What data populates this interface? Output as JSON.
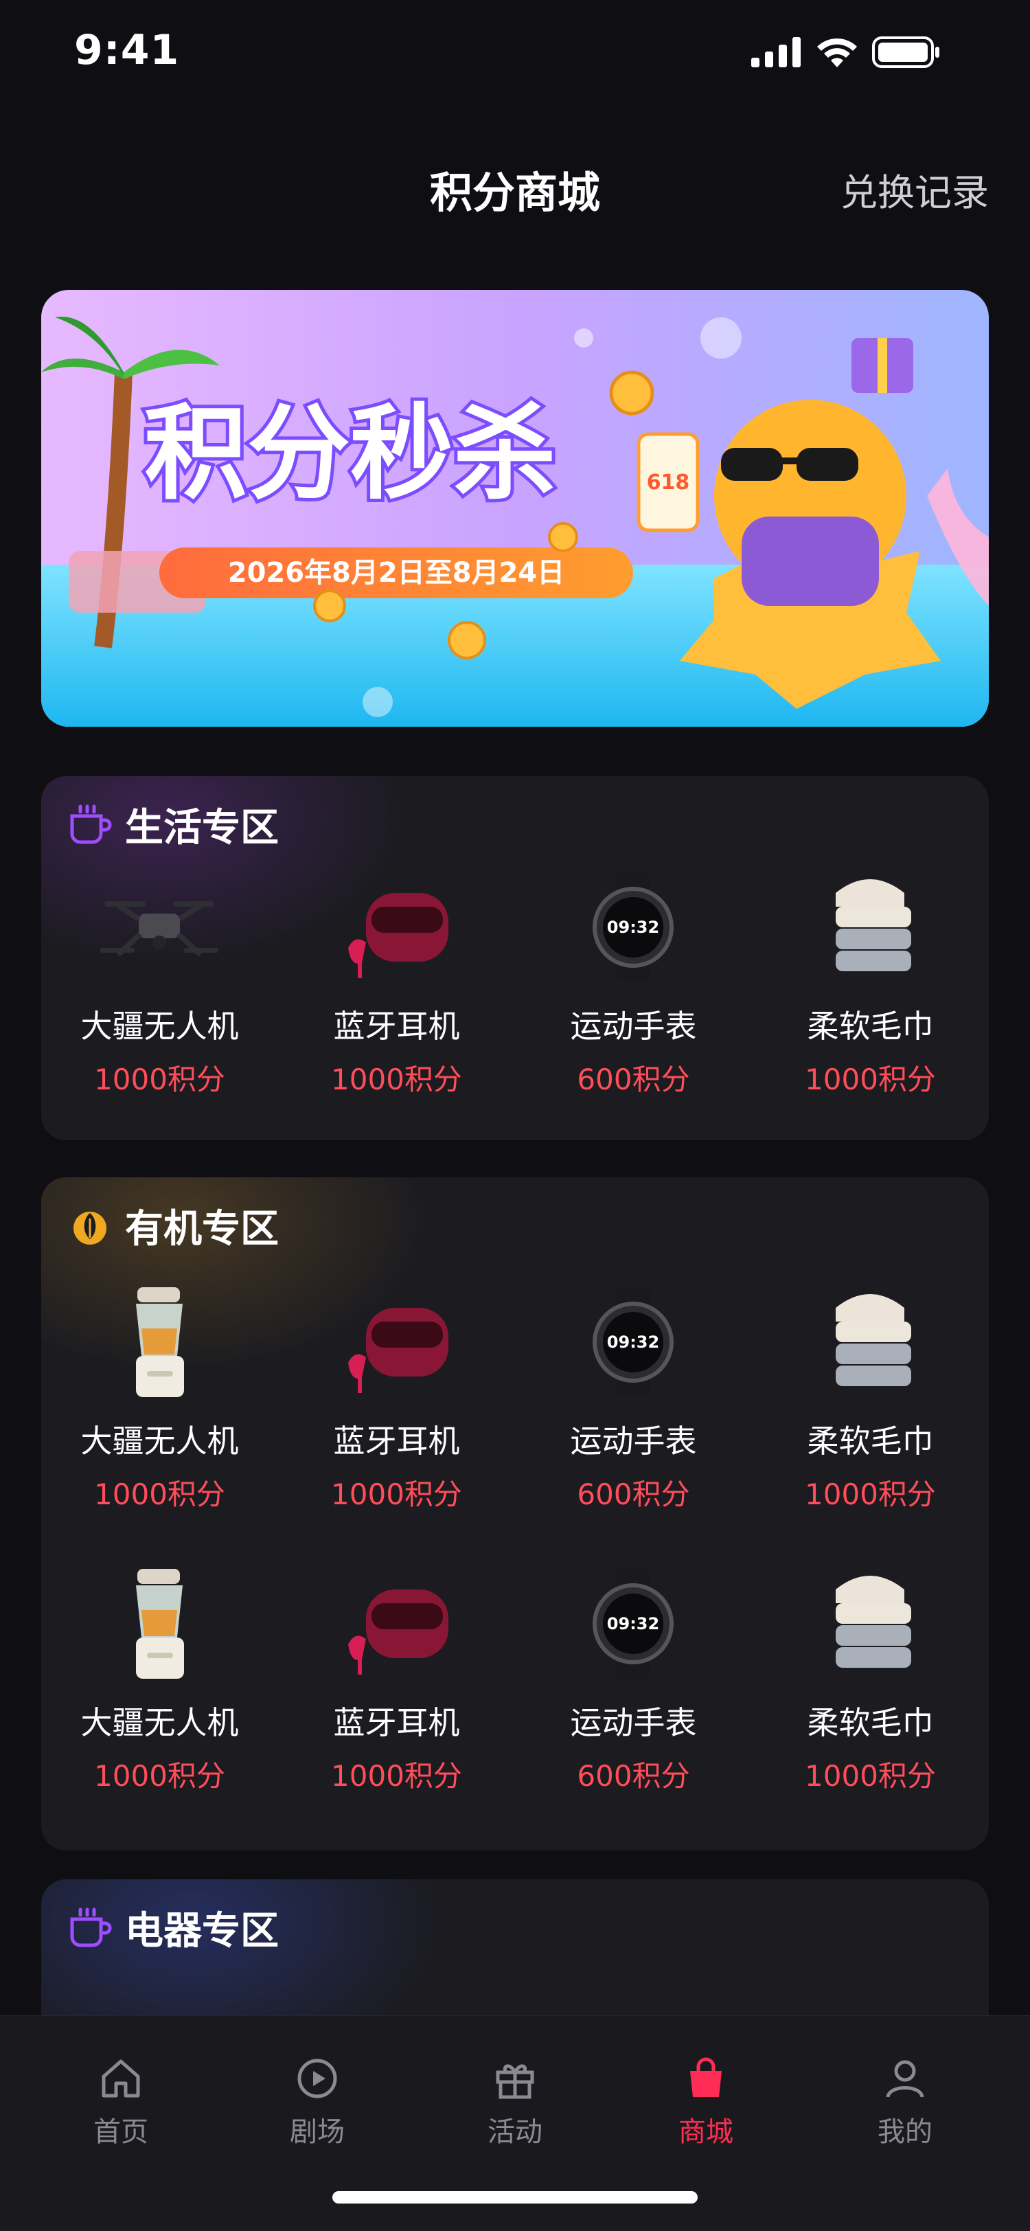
{
  "status": {
    "time": "9:41"
  },
  "header": {
    "title": "积分商城",
    "history": "兑换记录"
  },
  "banner": {
    "headline": "积分秒杀",
    "dates": "2026年8月2日至8月24日",
    "phone_number": "618"
  },
  "sections": [
    {
      "title": "生活专区",
      "icon": "cup-icon",
      "items": [
        {
          "name": "大疆无人机",
          "price": "1000积分",
          "icon": "drone-icon"
        },
        {
          "name": "蓝牙耳机",
          "price": "1000积分",
          "icon": "earbuds-icon"
        },
        {
          "name": "运动手表",
          "price": "600积分",
          "icon": "watch-icon"
        },
        {
          "name": "柔软毛巾",
          "price": "1000积分",
          "icon": "towel-icon"
        }
      ]
    },
    {
      "title": "有机专区",
      "icon": "leaf-icon",
      "items": [
        {
          "name": "大疆无人机",
          "price": "1000积分",
          "icon": "blender-icon"
        },
        {
          "name": "蓝牙耳机",
          "price": "1000积分",
          "icon": "earbuds-icon"
        },
        {
          "name": "运动手表",
          "price": "600积分",
          "icon": "watch-icon"
        },
        {
          "name": "柔软毛巾",
          "price": "1000积分",
          "icon": "towel-icon"
        },
        {
          "name": "大疆无人机",
          "price": "1000积分",
          "icon": "blender-icon"
        },
        {
          "name": "蓝牙耳机",
          "price": "1000积分",
          "icon": "earbuds-icon"
        },
        {
          "name": "运动手表",
          "price": "600积分",
          "icon": "watch-icon"
        },
        {
          "name": "柔软毛巾",
          "price": "1000积分",
          "icon": "towel-icon"
        }
      ]
    },
    {
      "title": "电器专区",
      "icon": "cup-icon"
    }
  ],
  "tabs": [
    {
      "label": "首页",
      "icon": "home-icon"
    },
    {
      "label": "剧场",
      "icon": "play-icon"
    },
    {
      "label": "活动",
      "icon": "gift-icon"
    },
    {
      "label": "商城",
      "icon": "shopping-bag-icon",
      "active": true
    },
    {
      "label": "我的",
      "icon": "user-icon"
    }
  ],
  "colors": {
    "accent": "#ff2d55",
    "price": "#ff4d5a",
    "background": "#0f0f13",
    "card": "#1b1b20"
  }
}
